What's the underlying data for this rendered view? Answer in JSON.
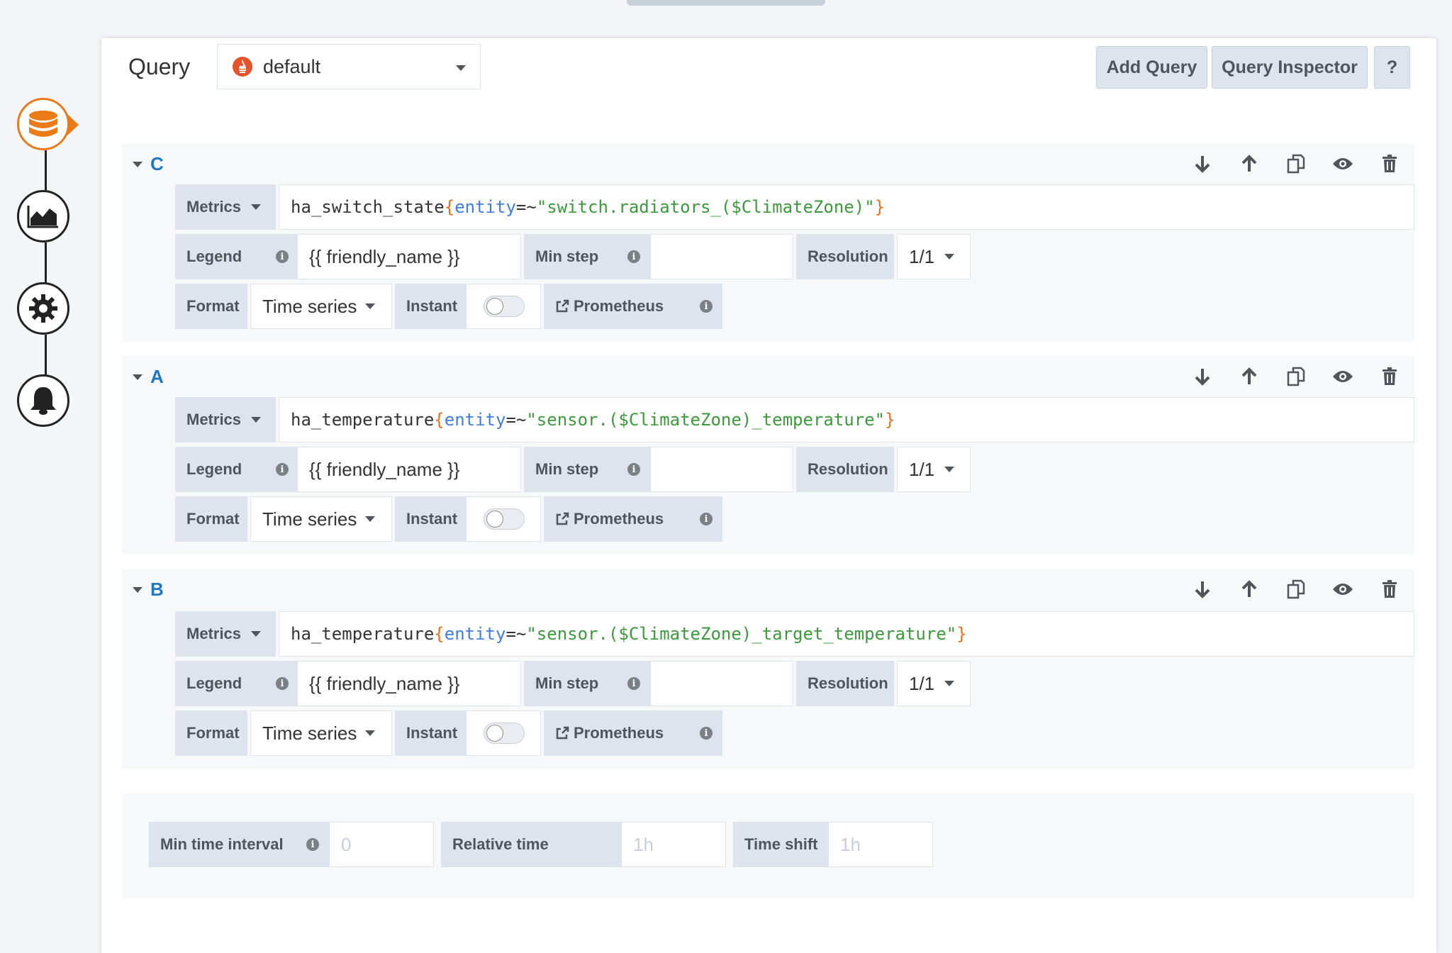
{
  "header": {
    "title": "Query",
    "datasource": "default",
    "add_query": "Add Query",
    "query_inspector": "Query Inspector",
    "help": "?"
  },
  "nav": {
    "icons": [
      "database-icon",
      "chart-icon",
      "gear-icon",
      "bell-icon"
    ],
    "accent": "#eb7b18"
  },
  "queries": [
    {
      "letter": "C",
      "metrics_label": "Metrics",
      "metric_name": "ha_switch_state",
      "open_brace": "{",
      "key": "entity",
      "op": "=~",
      "value": "\"switch.radiators_($ClimateZone)\"",
      "close_brace": "}",
      "legend_label": "Legend",
      "legend_value": "{{ friendly_name }}",
      "min_step_label": "Min step",
      "min_step_value": "",
      "resolution_label": "Resolution",
      "resolution_value": "1/1",
      "format_label": "Format",
      "format_value": "Time series",
      "instant_label": "Instant",
      "prometheus_link": "Prometheus"
    },
    {
      "letter": "A",
      "metrics_label": "Metrics",
      "metric_name": "ha_temperature",
      "open_brace": "{",
      "key": "entity",
      "op": "=~",
      "value": "\"sensor.($ClimateZone)_temperature\"",
      "close_brace": "}",
      "legend_label": "Legend",
      "legend_value": "{{ friendly_name }}",
      "min_step_label": "Min step",
      "min_step_value": "",
      "resolution_label": "Resolution",
      "resolution_value": "1/1",
      "format_label": "Format",
      "format_value": "Time series",
      "instant_label": "Instant",
      "prometheus_link": "Prometheus"
    },
    {
      "letter": "B",
      "metrics_label": "Metrics",
      "metric_name": "ha_temperature",
      "open_brace": "{",
      "key": "entity",
      "op": "=~",
      "value": "\"sensor.($ClimateZone)_target_temperature\"",
      "close_brace": "}",
      "legend_label": "Legend",
      "legend_value": "{{ friendly_name }}",
      "min_step_label": "Min step",
      "min_step_value": "",
      "resolution_label": "Resolution",
      "resolution_value": "1/1",
      "format_label": "Format",
      "format_value": "Time series",
      "instant_label": "Instant",
      "prometheus_link": "Prometheus"
    }
  ],
  "options": {
    "min_interval_label": "Min time interval",
    "min_interval_placeholder": "0",
    "relative_time_label": "Relative time",
    "relative_time_placeholder": "1h",
    "time_shift_label": "Time shift",
    "time_shift_placeholder": "1h"
  }
}
